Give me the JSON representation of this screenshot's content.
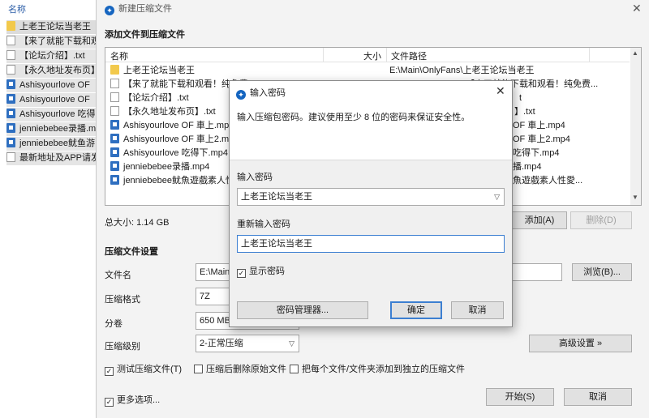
{
  "explorer": {
    "header": "名称",
    "items": [
      {
        "label": "上老王论坛当老王",
        "icon": "folder-icon"
      },
      {
        "label": "【来了就能下载和观看",
        "icon": "document-icon"
      },
      {
        "label": "【论坛介绍】.txt",
        "icon": "document-icon"
      },
      {
        "label": "【永久地址发布页】",
        "icon": "document-icon"
      },
      {
        "label": "Ashisyourlove OF",
        "icon": "video-icon"
      },
      {
        "label": "Ashisyourlove OF",
        "icon": "video-icon"
      },
      {
        "label": "Ashisyourlove 吃得",
        "icon": "video-icon"
      },
      {
        "label": "jenniebebee录播.m",
        "icon": "video-icon"
      },
      {
        "label": "jenniebebee鱿鱼游",
        "icon": "video-icon"
      },
      {
        "label": "最新地址及APP请发",
        "icon": "document-icon"
      }
    ]
  },
  "main": {
    "title": "新建压缩文件",
    "close": "✕",
    "section_add": "添加文件到压缩文件",
    "columns": {
      "name": "名称",
      "size": "大小",
      "path": "文件路径"
    },
    "files": [
      {
        "name": "上老王论坛当老王",
        "path": "E:\\Main\\OnlyFans\\上老王论坛当老王",
        "icon": "folder-icon"
      },
      {
        "name": "【来了就能下载和观看！纯免费",
        "path": "【来了就能下载和观看！纯免费...",
        "icon": "document-icon"
      },
      {
        "name": "【论坛介绍】.txt",
        "path": "t",
        "icon": "document-icon"
      },
      {
        "name": "【永久地址发布页】.txt",
        "path": "】.txt",
        "icon": "document-icon"
      },
      {
        "name": "Ashisyourlove OF 車上.mp4",
        "path": "OF 車上.mp4",
        "icon": "video-icon"
      },
      {
        "name": "Ashisyourlove OF 車上2.mp4",
        "path": "OF 車上2.mp4",
        "icon": "video-icon"
      },
      {
        "name": "Ashisyourlove 吃得下.mp4",
        "path": "吃得下.mp4",
        "icon": "video-icon"
      },
      {
        "name": "jenniebebee录播.mp4",
        "path": "播.mp4",
        "icon": "video-icon"
      },
      {
        "name": "jenniebebee鱿魚遊戲素人性愛",
        "path": "魚遊戲素人性愛...",
        "icon": "video-icon"
      }
    ],
    "total_size": "总大小: 1.14 GB",
    "add_button": "添加(A)",
    "delete_button": "删除(D)",
    "section_settings": "压缩文件设置",
    "labels": {
      "filename": "文件名",
      "format": "压缩格式",
      "split": "分卷",
      "level": "压缩级别"
    },
    "filename_value": "E:\\Main\\",
    "format_value": "7Z",
    "split_value": "650 MB",
    "level_value": "2-正常压缩",
    "browse_button": "浏览(B)...",
    "advanced_button": "高级设置 »",
    "checkboxes": {
      "test": "测试压缩文件(T)",
      "delete_after": "压缩后删除原始文件",
      "each_separate": "把每个文件/文件夹添加到独立的压缩文件",
      "more_options": "更多选项..."
    },
    "start_button": "开始(S)",
    "cancel_button": "取消"
  },
  "password_dialog": {
    "title": "输入密码",
    "close": "✕",
    "description": "输入压缩包密码。建议使用至少 8 位的密码来保证安全性。",
    "enter_label": "输入密码",
    "enter_value": "上老王论坛当老王",
    "reenter_label": "重新输入密码",
    "reenter_value": "上老王论坛当老王",
    "show_password": "显示密码",
    "manager_button": "密码管理器...",
    "ok_button": "确定",
    "cancel_button": "取消"
  }
}
